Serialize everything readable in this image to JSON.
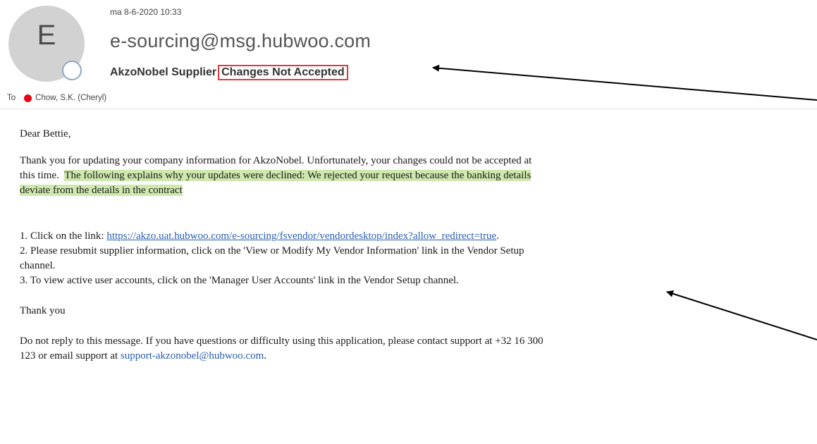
{
  "header": {
    "avatar_letter": "E",
    "date": "ma 8-6-2020 10:33",
    "sender": "e-sourcing@msg.hubwoo.com",
    "subject_prefix": "AkzoNobel Supplier",
    "subject_highlight": "Changes Not Accepted",
    "to_label": "To",
    "recipient": "Chow, S.K. (Cheryl)"
  },
  "body": {
    "greeting": "Dear Bettie,",
    "para1_line1": "Thank you for updating your company information for AkzoNobel.  Unfortunately, your changes could not be accepted at",
    "para1_line2_plain": "this time.",
    "para1_line2_highlight": "The following explains why your updates were declined: We rejected your request because the banking details",
    "para1_line3_highlight": "deviate from the details in the contract",
    "step1_prefix": "1. Click on the link: ",
    "step1_link": "https://akzo.uat.hubwoo.com/e-sourcing/fsvendor/vendordesktop/index?allow_redirect=true",
    "step1_suffix": ".",
    "step2_line1": "2. Please resubmit supplier information, click on the 'View or Modify My Vendor Information' link in the Vendor Setup",
    "step2_line2": "channel.",
    "step3": "3. To view active user accounts, click on the 'Manager User Accounts' link in the Vendor Setup channel.",
    "thanks": "Thank you",
    "footer_line1": "Do not reply to this message.  If you have questions or difficulty using this application, please contact support at +32 16 300",
    "footer_line2_prefix": "123 or email support at ",
    "support_email": "support-akzonobel@hubwoo.com",
    "footer_line2_suffix": "."
  },
  "colors": {
    "highlight_box": "#e0383b",
    "text_highlight": "#cfe8ae",
    "link": "#2a5db0",
    "presence_dot": "#e30613"
  }
}
